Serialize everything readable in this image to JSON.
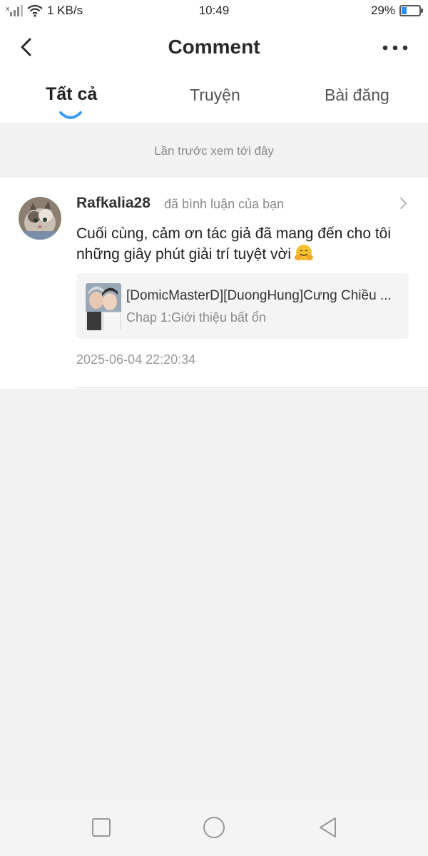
{
  "status_bar": {
    "speed": "1 KB/s",
    "time": "10:49",
    "battery": "29%",
    "battery_level": 0.29
  },
  "header": {
    "title": "Comment",
    "back_icon": "chevron-left-icon",
    "more_icon": "more-horizontal-icon"
  },
  "tabs": [
    {
      "label": "Tất cả",
      "active": true
    },
    {
      "label": "Truyện",
      "active": false
    },
    {
      "label": "Bài đăng",
      "active": false
    }
  ],
  "last_viewed": "Lần trước xem tới đây",
  "comments": [
    {
      "username": "Rafkalia28",
      "action": "đã bình luận của bạn",
      "body": "Cuối cùng, cảm ơn tác giả đã mang đến cho tôi những giây phút giải trí tuyệt vời",
      "emoji": "hugging-face-emoji",
      "story": {
        "title": "[DomicMasterD][DuongHung]Cưng Chiều ...",
        "chapter": "Chap 1:Giới thiệu bất ổn"
      },
      "timestamp": "2025-06-04 22:20:34"
    }
  ],
  "colors": {
    "accent": "#3b9bf2",
    "background": "#f2f2f3"
  }
}
